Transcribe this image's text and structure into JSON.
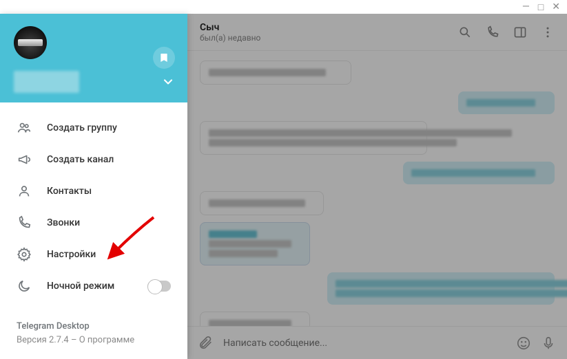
{
  "window": {
    "minimize": "—",
    "maximize": "□",
    "close": "✕"
  },
  "sidebar": {
    "items": [
      {
        "label": "Создать группу"
      },
      {
        "label": "Создать канал"
      },
      {
        "label": "Контакты"
      },
      {
        "label": "Звонки"
      },
      {
        "label": "Настройки"
      },
      {
        "label": "Ночной режим"
      }
    ],
    "footer": {
      "app_name": "Telegram Desktop",
      "version_line": "Версия 2.7.4 – О программе"
    }
  },
  "chat": {
    "title": "Сыч",
    "status": "был(а) недавно",
    "input_placeholder": "Написать сообщение..."
  }
}
